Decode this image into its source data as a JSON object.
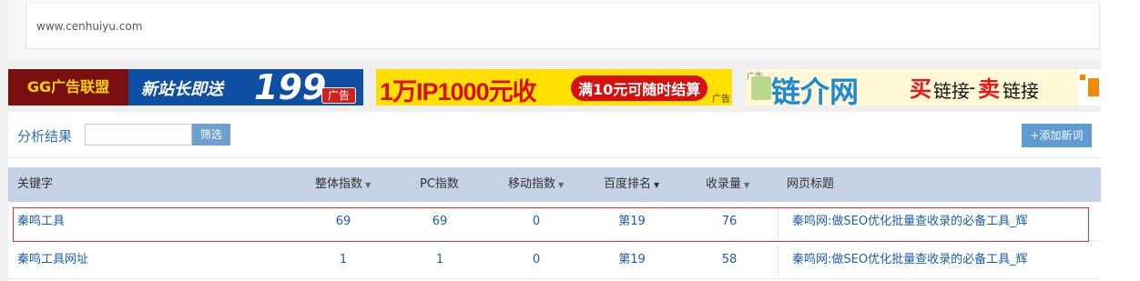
{
  "site_url": "www.cenhuiyu.com",
  "ads": {
    "ad1": {
      "brand": "GG广告联盟",
      "slogan": "新站长即送",
      "amount": "199",
      "tag": "广告"
    },
    "ad2": {
      "main": "1万IP1000元收",
      "pill": "满10元可随时结算",
      "tag": "广告"
    },
    "ad3": {
      "corner": "广告",
      "brand": "链介网",
      "buy": "买",
      "link1": "链接",
      "dash": "-",
      "sell": "卖",
      "link2": "链接"
    }
  },
  "toolbar": {
    "title": "分析结果",
    "filter_input_value": "",
    "filter_button": "筛选",
    "add_button": "+添加新词"
  },
  "table": {
    "headers": {
      "keyword": "关键字",
      "overall": "整体指数",
      "pc": "PC指数",
      "mobile": "移动指数",
      "baidu_rank": "百度排名",
      "indexed": "收录量",
      "page_title": "网页标题"
    },
    "rows": [
      {
        "keyword": "秦鸣工具",
        "overall": "69",
        "pc": "69",
        "mobile": "0",
        "baidu_rank": "第19",
        "indexed": "76",
        "page_title": "秦鸣网:做SEO优化批量查收录的必备工具_辉"
      },
      {
        "keyword": "秦鸣工具网址",
        "overall": "1",
        "pc": "1",
        "mobile": "0",
        "baidu_rank": "第19",
        "indexed": "58",
        "page_title": "秦鸣网:做SEO优化批量查收录的必备工具_辉"
      }
    ]
  },
  "colors": {
    "header_bg": "#c5d2e6",
    "link": "#1a5ea8",
    "highlight_border": "#d23b3b",
    "button": "#5f9ad3"
  }
}
